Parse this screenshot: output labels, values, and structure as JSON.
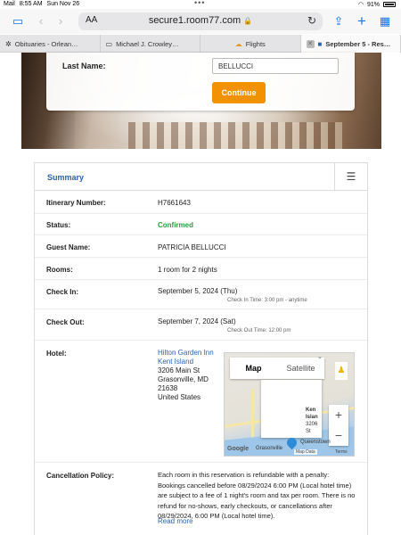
{
  "status_bar": {
    "carrier": "Mail",
    "time": "8:55 AM",
    "date": "Sun Nov 26",
    "dots": "•••",
    "battery": "91%"
  },
  "toolbar": {
    "text_size": "AA",
    "url": "secure1.room77.com",
    "lock": "🔒"
  },
  "tabs": [
    {
      "label": "Obituaries - Orlean…",
      "icon": "obituary-favicon"
    },
    {
      "label": "Michael J. Crowley…",
      "icon": "page-favicon"
    },
    {
      "label": "Flights",
      "icon": "flights-favicon"
    },
    {
      "label": "September 5 - Res…",
      "icon": "room77-favicon",
      "active": true
    }
  ],
  "login": {
    "last_name_label": "Last Name:",
    "last_name_value": "BELLUCCI",
    "continue_label": "Continue"
  },
  "summary": {
    "title": "Summary",
    "itinerary_label": "Itinerary Number:",
    "itinerary_value": "H7661643",
    "status_label": "Status:",
    "status_value": "Confirmed",
    "guest_label": "Guest Name:",
    "guest_value": "PATRICIA BELLUCCI",
    "rooms_label": "Rooms:",
    "rooms_value": "1 room for 2 nights",
    "checkin_label": "Check In:",
    "checkin_value": "September 5, 2024 (Thu)",
    "checkin_time": "Check In Time: 3:00 pm - anytime",
    "checkout_label": "Check Out:",
    "checkout_value": "September 7, 2024 (Sat)",
    "checkout_time": "Check Out Time: 12:00 pm",
    "hotel_label": "Hotel:",
    "hotel_name_1": "Hilton Garden Inn",
    "hotel_name_2": "Kent Island",
    "hotel_addr_1": "3206 Main St",
    "hotel_addr_2": "Grasonville, MD",
    "hotel_addr_3": "21638",
    "hotel_addr_4": "United States",
    "policy_label": "Cancellation Policy:",
    "policy_text": "Each room in this reservation is refundable with a penalty: Bookings cancelled before 08/29/2024 6:00 PM (Local hotel time) are subject to a fee of 1 night's room and tax per room. There is no refund for no-shows, early checkouts, or cancellations after 08/29/2024, 6:00 PM (Local hotel time).",
    "read_more": "Read more"
  },
  "map": {
    "tab_map": "Map",
    "tab_satellite": "Satellite",
    "popup_lines": [
      "Ken",
      "Islan",
      "3206",
      "St",
      "Gras",
      "MD :"
    ],
    "place_1": "Queenstown",
    "place_2": "Grasonville",
    "google": "Google",
    "attribution": "Map Data",
    "terms": "Terms",
    "zoom_in": "+",
    "zoom_out": "−"
  }
}
